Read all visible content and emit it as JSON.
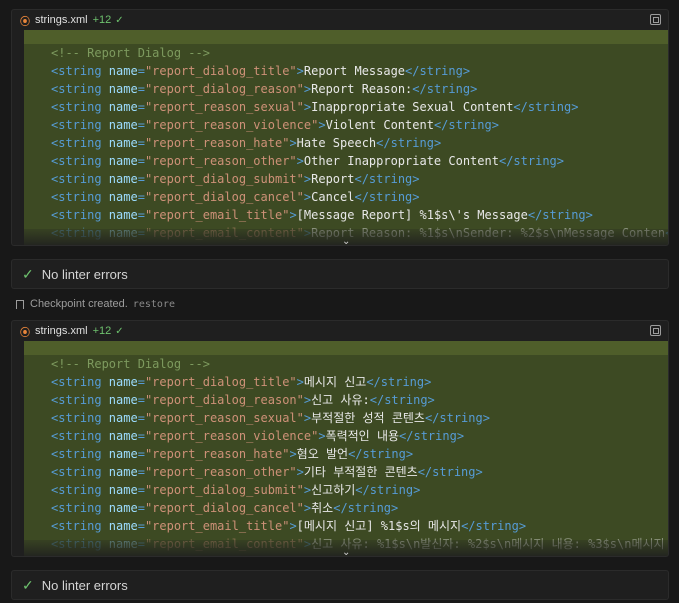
{
  "blocks": [
    {
      "file": "strings.xml",
      "added": "+12",
      "lines": [
        {
          "kind": "comment",
          "text": "<!-- Report Dialog -->"
        },
        {
          "kind": "string",
          "name": "report_dialog_title",
          "value": "Report Message"
        },
        {
          "kind": "string",
          "name": "report_dialog_reason",
          "value": "Report Reason:"
        },
        {
          "kind": "string",
          "name": "report_reason_sexual",
          "value": "Inappropriate Sexual Content"
        },
        {
          "kind": "string",
          "name": "report_reason_violence",
          "value": "Violent Content"
        },
        {
          "kind": "string",
          "name": "report_reason_hate",
          "value": "Hate Speech"
        },
        {
          "kind": "string",
          "name": "report_reason_other",
          "value": "Other Inappropriate Content"
        },
        {
          "kind": "string",
          "name": "report_dialog_submit",
          "value": "Report"
        },
        {
          "kind": "string",
          "name": "report_dialog_cancel",
          "value": "Cancel"
        },
        {
          "kind": "string",
          "name": "report_email_title",
          "value": "[Message Report] %1$s\\'s Message"
        },
        {
          "kind": "string",
          "name": "report_email_content",
          "value": "Report Reason: %1$s\\nSender: %2$s\\nMessage Conten"
        }
      ],
      "linter": "No linter errors"
    },
    {
      "file": "strings.xml",
      "added": "+12",
      "lines": [
        {
          "kind": "comment",
          "text": "<!-- Report Dialog -->"
        },
        {
          "kind": "string",
          "name": "report_dialog_title",
          "value": "메시지 신고"
        },
        {
          "kind": "string",
          "name": "report_dialog_reason",
          "value": "신고 사유:"
        },
        {
          "kind": "string",
          "name": "report_reason_sexual",
          "value": "부적절한 성적 콘텐츠"
        },
        {
          "kind": "string",
          "name": "report_reason_violence",
          "value": "폭력적인 내용"
        },
        {
          "kind": "string",
          "name": "report_reason_hate",
          "value": "혐오 발언"
        },
        {
          "kind": "string",
          "name": "report_reason_other",
          "value": "기타 부적절한 콘텐츠"
        },
        {
          "kind": "string",
          "name": "report_dialog_submit",
          "value": "신고하기"
        },
        {
          "kind": "string",
          "name": "report_dialog_cancel",
          "value": "취소"
        },
        {
          "kind": "string",
          "name": "report_email_title",
          "value": "[메시지 신고] %1$s의 메시지"
        },
        {
          "kind": "string",
          "name": "report_email_content",
          "value": "신고 사유: %1$s\\n발신자: %2$s\\n메시지 내용: %3$s\\n메시지 ?"
        }
      ],
      "linter": "No linter errors"
    }
  ],
  "checkpoint": {
    "text": "Checkpoint created.",
    "action": "restore"
  },
  "icons": {
    "file": "rss-icon",
    "copy": "copy-icon",
    "expand": "chevron-down-icon",
    "ok": "checkmark-icon",
    "checkpoint": "bookmark-icon"
  },
  "colors": {
    "added": "#6ec26e",
    "diff_bg": "#3d4a23",
    "file_icon": "#e8853a"
  }
}
